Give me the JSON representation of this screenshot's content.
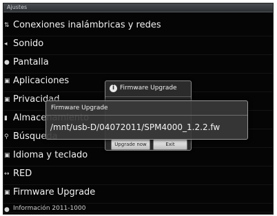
{
  "window": {
    "title": "Ajustes"
  },
  "settings": {
    "items": [
      {
        "label": "Conexiones inalámbricas y redes",
        "icon": "wireless-icon",
        "glyph": "⇅"
      },
      {
        "label": "Sonido",
        "icon": "speaker-icon",
        "glyph": "◂"
      },
      {
        "label": "Pantalla",
        "icon": "display-icon",
        "glyph": "●"
      },
      {
        "label": "Aplicaciones",
        "icon": "apps-icon",
        "glyph": "▣"
      },
      {
        "label": "Privacidad",
        "icon": "privacy-icon",
        "glyph": "▣"
      },
      {
        "label": "Almacenamiento",
        "icon": "storage-icon",
        "glyph": "▮"
      },
      {
        "label": "Búsqueda",
        "icon": "search-icon",
        "glyph": "⚲"
      },
      {
        "label": "Idioma y teclado",
        "icon": "language-icon",
        "glyph": "▣"
      },
      {
        "label": "RED",
        "icon": "network-icon",
        "glyph": "↔"
      },
      {
        "label": "Firmware Upgrade",
        "icon": "firmware-icon",
        "glyph": "▣"
      },
      {
        "label": "Información 2011-1000",
        "icon": "info-icon",
        "glyph": "●"
      }
    ]
  },
  "firmware_dialog": {
    "title": "Firmware Upgrade",
    "upgrade_label": "Upgrade now",
    "exit_label": "Exit"
  },
  "file_dialog": {
    "title": "Firmware Upgrade",
    "path": "/mnt/usb-D/04072011/SPM4000_1.2.2.fw"
  }
}
